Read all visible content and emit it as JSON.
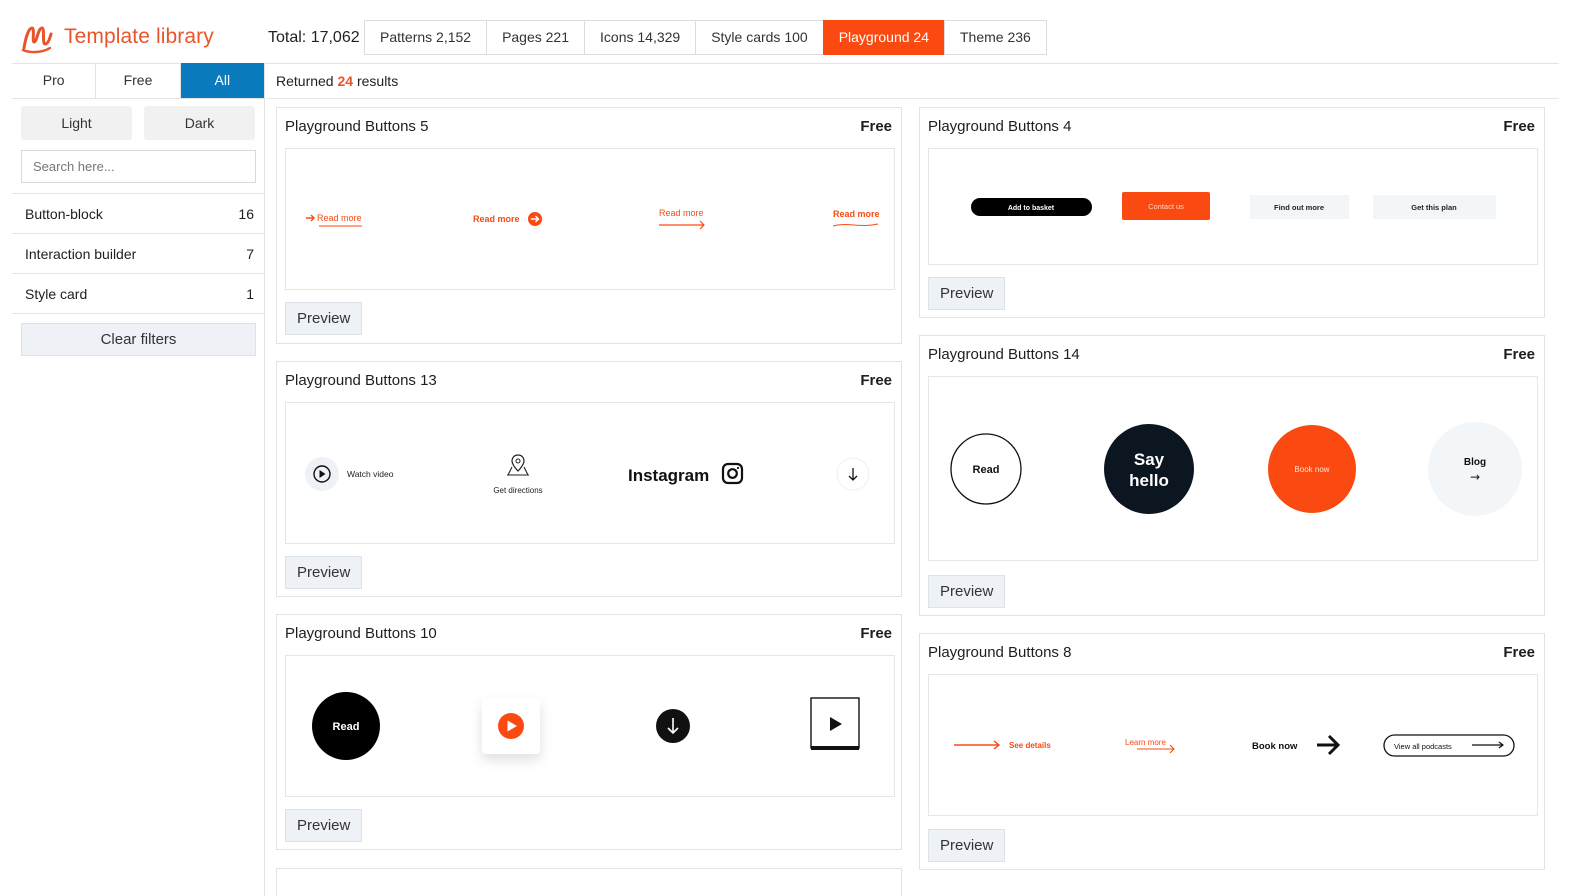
{
  "header": {
    "brand": "Template library",
    "total": "Total: 17,062",
    "categories": [
      {
        "label": "Patterns 2,152"
      },
      {
        "label": "Pages 221"
      },
      {
        "label": "Icons 14,329"
      },
      {
        "label": "Style cards 100"
      },
      {
        "label": "Playground 24",
        "active": true
      },
      {
        "label": "Theme 236"
      }
    ]
  },
  "sidebar": {
    "plan_tabs": [
      "Pro",
      "Free",
      "All"
    ],
    "active_plan": "All",
    "themes": [
      "Light",
      "Dark"
    ],
    "search_placeholder": "Search here...",
    "filters": [
      {
        "label": "Button-block",
        "count": "16"
      },
      {
        "label": "Interaction builder",
        "count": "7"
      },
      {
        "label": "Style card",
        "count": "1"
      }
    ],
    "clear_label": "Clear filters"
  },
  "results": {
    "prefix": "Returned",
    "count": "24",
    "suffix": "results"
  },
  "preview_label": "Preview",
  "cards": [
    {
      "title": "Playground Buttons 5",
      "badge": "Free",
      "thumb": {
        "read1": "Read more",
        "read2": "Read more",
        "read3": "Read more",
        "read4": "Read more"
      }
    },
    {
      "title": "Playground Buttons 4",
      "badge": "Free",
      "thumb": {
        "b1": "Add to basket",
        "b2": "Contact us",
        "b3": "Find out more",
        "b4": "Get this plan"
      }
    },
    {
      "title": "Playground Buttons 13",
      "badge": "Free",
      "thumb": {
        "watch": "Watch video",
        "directions": "Get directions",
        "instagram": "Instagram"
      }
    },
    {
      "title": "Playground Buttons 14",
      "badge": "Free",
      "thumb": {
        "read": "Read",
        "say1": "Say",
        "say2": "hello",
        "book": "Book now",
        "blog": "Blog",
        "arrow": "→"
      }
    },
    {
      "title": "Playground Buttons 10",
      "badge": "Free",
      "thumb": {
        "read": "Read"
      }
    },
    {
      "title": "Playground Buttons 8",
      "badge": "Free",
      "thumb": {
        "details": "See details",
        "learn": "Learn more",
        "book": "Book now",
        "podcasts": "View all podcasts"
      }
    }
  ],
  "colors": {
    "accent": "#fa4a12",
    "brand": "#e8552b",
    "active_tab": "#0a7cbe",
    "dark": "#0b1620"
  },
  "icons": [
    "logo-icon",
    "play-circle-icon",
    "map-pin-icon",
    "instagram-icon",
    "arrow-down-icon",
    "arrow-right-icon",
    "play-icon"
  ]
}
